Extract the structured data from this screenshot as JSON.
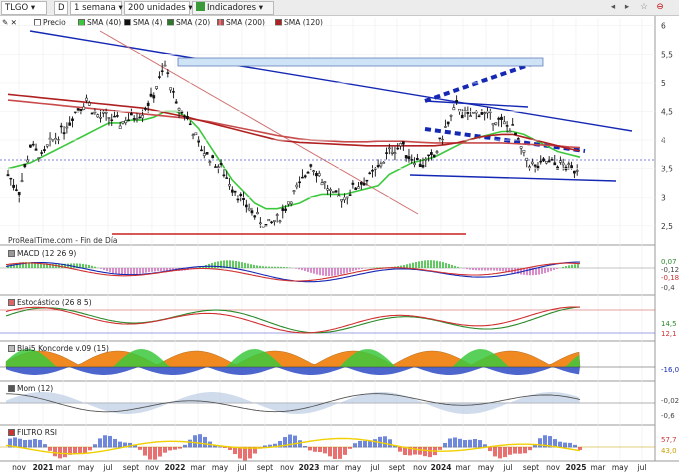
{
  "toolbar": {
    "symbol": "TLGO",
    "type_letter": "D",
    "period": "1 semana",
    "units": "200 unidades",
    "indicators": "Indicadores",
    "star": "☆",
    "window_controls": "⊖",
    "nav_left": "◂",
    "nav_right": "▸"
  },
  "legend": {
    "price": "Precio",
    "sma40": "SMA (40)",
    "sma4": "SMA (4)",
    "sma20": "SMA (20)",
    "sma200": "SMA (200)",
    "sma120": "SMA (120)"
  },
  "source_label": "ProRealTime.com - Fin de Día",
  "panels": {
    "macd": "MACD (12 26 9)",
    "stoch": "Estocástico (26 8 5)",
    "blai5": "Blai5 Koncorde v.09 (15)",
    "mom": "Mom (12)",
    "rsi": "FILTRO RSI"
  },
  "colors": {
    "price": "#111111",
    "sma40": "#3cc83c",
    "sma20": "#2a7a2a",
    "sma200": "#c84a4a",
    "sma120": "#b02020",
    "trend_blue": "#1428b4",
    "support_red": "#cc2020"
  },
  "price_axis_labels": [
    "6",
    "5,5",
    "5",
    "4,5",
    "4",
    "3,5",
    "3",
    "2,5"
  ],
  "price_tags": [
    {
      "text": "3,870",
      "color": "#e07070"
    },
    {
      "text": "3,81",
      "color": "#c02020"
    },
    {
      "text": "3,530",
      "color": "#e8a000"
    },
    {
      "text": "3,470",
      "color": "#888888"
    }
  ],
  "macd_axis": [
    "0,07",
    "-0,12",
    "-0,18",
    "-0,4"
  ],
  "stoch_axis": [
    "14,5",
    "12,1"
  ],
  "blai5_axis": [
    "-16,0"
  ],
  "mom_axis": [
    "-0,02",
    "-0,6"
  ],
  "rsi_axis": [
    "57,7",
    "43,0"
  ],
  "x_axis": [
    {
      "label": "nov",
      "x": 19,
      "bold": false
    },
    {
      "label": "2021",
      "x": 43,
      "bold": true
    },
    {
      "label": "mar",
      "x": 63,
      "bold": false
    },
    {
      "label": "may",
      "x": 86,
      "bold": false
    },
    {
      "label": "jul",
      "x": 108,
      "bold": false
    },
    {
      "label": "sept",
      "x": 131,
      "bold": false
    },
    {
      "label": "nov",
      "x": 152,
      "bold": false
    },
    {
      "label": "2022",
      "x": 175,
      "bold": true
    },
    {
      "label": "mar",
      "x": 198,
      "bold": false
    },
    {
      "label": "may",
      "x": 220,
      "bold": false
    },
    {
      "label": "jul",
      "x": 242,
      "bold": false
    },
    {
      "label": "sept",
      "x": 265,
      "bold": false
    },
    {
      "label": "nov",
      "x": 287,
      "bold": false
    },
    {
      "label": "2023",
      "x": 309,
      "bold": true
    },
    {
      "label": "mar",
      "x": 331,
      "bold": false
    },
    {
      "label": "may",
      "x": 353,
      "bold": false
    },
    {
      "label": "jul",
      "x": 375,
      "bold": false
    },
    {
      "label": "sept",
      "x": 397,
      "bold": false
    },
    {
      "label": "nov",
      "x": 420,
      "bold": false
    },
    {
      "label": "2024",
      "x": 441,
      "bold": true
    },
    {
      "label": "mar",
      "x": 463,
      "bold": false
    },
    {
      "label": "may",
      "x": 486,
      "bold": false
    },
    {
      "label": "jul",
      "x": 508,
      "bold": false
    },
    {
      "label": "sept",
      "x": 531,
      "bold": false
    },
    {
      "label": "nov",
      "x": 553,
      "bold": false
    },
    {
      "label": "2025",
      "x": 576,
      "bold": true
    },
    {
      "label": "mar",
      "x": 598,
      "bold": false
    },
    {
      "label": "may",
      "x": 620,
      "bold": false
    },
    {
      "label": "jul",
      "x": 642,
      "bold": false
    }
  ],
  "chart_data": {
    "type": "line",
    "title": "TLGO",
    "xlabel": "",
    "ylabel": "",
    "ylim": [
      2.2,
      6.1
    ],
    "x": [
      "2020-10",
      "2020-11",
      "2020-12",
      "2021-01",
      "2021-02",
      "2021-03",
      "2021-04",
      "2021-05",
      "2021-06",
      "2021-07",
      "2021-08",
      "2021-09",
      "2021-10",
      "2021-11",
      "2021-12",
      "2022-01",
      "2022-02",
      "2022-03",
      "2022-04",
      "2022-05",
      "2022-06",
      "2022-07",
      "2022-08",
      "2022-09",
      "2022-10",
      "2022-11",
      "2022-12",
      "2023-01",
      "2023-02",
      "2023-03",
      "2023-04",
      "2023-05",
      "2023-06",
      "2023-07",
      "2023-08",
      "2023-09",
      "2023-10",
      "2023-11",
      "2023-12",
      "2024-01",
      "2024-02",
      "2024-03",
      "2024-04",
      "2024-05",
      "2024-06",
      "2024-07",
      "2024-08",
      "2024-09",
      "2024-10",
      "2024-11",
      "2024-12",
      "2025-01"
    ],
    "series": [
      {
        "name": "Precio",
        "values": [
          3.4,
          3.1,
          3.9,
          3.7,
          4.0,
          4.2,
          4.5,
          4.7,
          4.4,
          4.4,
          4.3,
          4.4,
          4.5,
          4.8,
          5.3,
          4.6,
          4.4,
          3.9,
          3.7,
          3.5,
          3.2,
          2.9,
          2.7,
          2.5,
          2.6,
          2.9,
          3.2,
          3.6,
          3.3,
          3.0,
          3.0,
          3.2,
          3.3,
          3.5,
          3.8,
          3.9,
          3.7,
          3.6,
          3.7,
          4.2,
          4.6,
          4.4,
          4.5,
          4.4,
          4.3,
          4.2,
          3.7,
          3.5,
          3.6,
          3.6,
          3.5,
          3.53
        ]
      },
      {
        "name": "SMA (40)",
        "values": [
          3.5,
          3.55,
          3.6,
          3.7,
          3.8,
          3.9,
          4.0,
          4.1,
          4.2,
          4.3,
          4.3,
          4.35,
          4.35,
          4.4,
          4.5,
          4.5,
          4.4,
          4.2,
          3.9,
          3.6,
          3.3,
          3.1,
          2.9,
          2.8,
          2.8,
          2.85,
          2.9,
          3.0,
          3.05,
          3.05,
          3.05,
          3.1,
          3.15,
          3.2,
          3.4,
          3.5,
          3.6,
          3.65,
          3.7,
          3.8,
          3.9,
          4.0,
          4.05,
          4.1,
          4.15,
          4.15,
          4.1,
          4.0,
          3.9,
          3.8,
          3.75,
          3.7
        ]
      },
      {
        "name": "SMA (200)",
        "values": [
          4.7,
          4.68,
          4.66,
          4.64,
          4.62,
          4.6,
          4.58,
          4.56,
          4.54,
          4.52,
          4.5,
          4.48,
          4.46,
          4.44,
          4.42,
          4.4,
          4.38,
          4.35,
          4.32,
          4.28,
          4.24,
          4.2,
          4.16,
          4.12,
          4.08,
          4.05,
          4.02,
          4.0,
          3.99,
          3.98,
          3.97,
          3.97,
          3.97,
          3.98,
          3.98,
          3.98,
          3.97,
          3.96,
          3.95,
          3.95,
          3.95,
          3.95,
          3.95,
          3.95,
          3.95,
          3.94,
          3.93,
          3.92,
          3.91,
          3.9,
          3.88,
          3.87
        ]
      },
      {
        "name": "SMA (120)",
        "values": [
          4.8,
          4.78,
          4.76,
          4.74,
          4.72,
          4.7,
          4.68,
          4.66,
          4.64,
          4.62,
          4.6,
          4.58,
          4.56,
          4.52,
          4.48,
          4.44,
          4.4,
          4.35,
          4.3,
          4.25,
          4.2,
          4.15,
          4.1,
          4.05,
          4.0,
          3.98,
          3.96,
          3.95,
          3.94,
          3.93,
          3.92,
          3.91,
          3.9,
          3.9,
          3.9,
          3.9,
          3.9,
          3.9,
          3.9,
          3.92,
          3.95,
          4.0,
          4.05,
          4.08,
          4.1,
          4.1,
          4.05,
          4.0,
          3.95,
          3.9,
          3.85,
          3.81
        ]
      }
    ]
  }
}
